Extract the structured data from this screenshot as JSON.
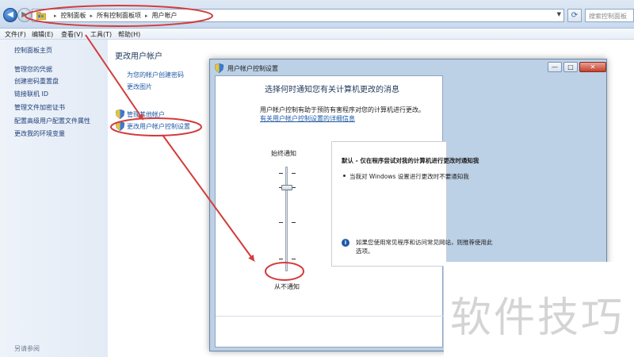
{
  "address": {
    "breadcrumbs": [
      "控制面板",
      "所有控制面板项",
      "用户帐户"
    ],
    "search_placeholder": "搜索控制面板"
  },
  "menu": [
    "文件(F)",
    "编辑(E)",
    "查看(V)",
    "工具(T)",
    "帮助(H)"
  ],
  "left_pane": {
    "home": "控制面板主页",
    "links": [
      "管理您的凭据",
      "创建密码重置盘",
      "链接联机 ID",
      "管理文件加密证书",
      "配置高级用户配置文件属性",
      "更改我的环境变量"
    ],
    "see_also": "另请参阅"
  },
  "main": {
    "title": "更改用户帐户",
    "links": [
      "为您的帐户创建密码",
      "更改图片"
    ],
    "manage_other": "管理其他帐户",
    "uac_settings": "更改用户帐户控制设置"
  },
  "dialog": {
    "title": "用户帐户控制设置",
    "controls": {
      "minimize": "—",
      "maximize": "□",
      "close": "✕"
    },
    "heading": "选择何时通知您有关计算机更改的消息",
    "description": "用户帐户控制有助于预防有害程序对您的计算机进行更改。",
    "learn_more": "有关用户帐户控制设置的详细信息",
    "label_always": "始终通知",
    "label_never": "从不通知",
    "slider_level": 3,
    "slider_levels": 4,
    "info_title": "默认 - 仅在程序尝试对我的计算机进行更改时通知我",
    "info_bullet": "当我对 Windows 设置进行更改时不要通知我",
    "info_note_line1": "如果您使用常见程序和访问常见网站，则推荐使用此",
    "info_note_line2": "选项。"
  },
  "watermark": "软件技巧",
  "colors": {
    "annotation": "#d23c3c",
    "link": "#1f5aa6",
    "heading": "#1e395b"
  }
}
